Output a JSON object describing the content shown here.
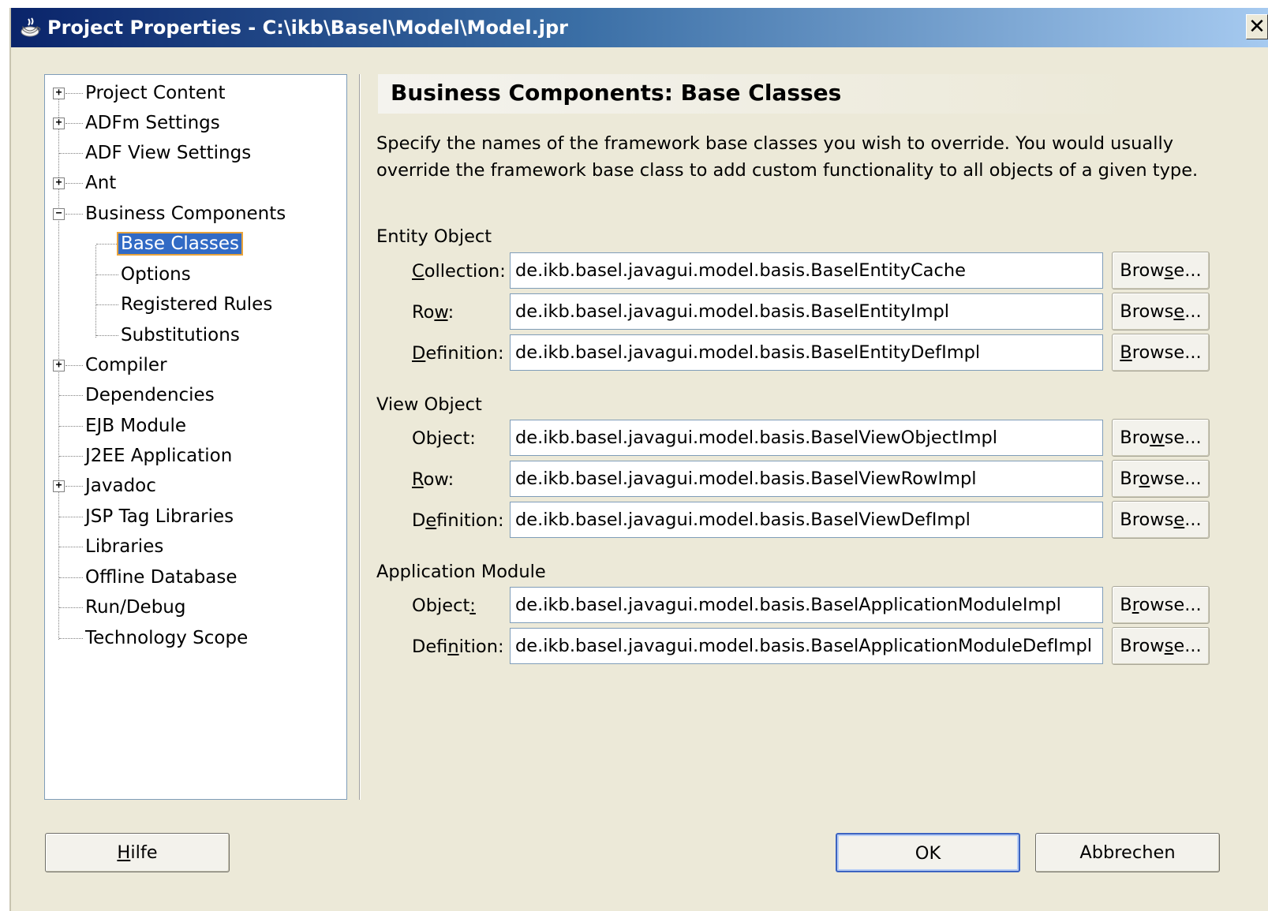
{
  "window": {
    "title": "Project Properties - C:\\ikb\\Basel\\Model\\Model.jpr",
    "close_glyph": "✕"
  },
  "tree": {
    "items": [
      {
        "label": "Project Content",
        "expander": "+"
      },
      {
        "label": "ADFm Settings",
        "expander": "+"
      },
      {
        "label": "ADF View Settings"
      },
      {
        "label": "Ant",
        "expander": "+"
      },
      {
        "label": "Business Components",
        "expander": "−"
      },
      {
        "label": "Base Classes",
        "selected": true
      },
      {
        "label": "Options"
      },
      {
        "label": "Registered Rules"
      },
      {
        "label": "Substitutions"
      },
      {
        "label": "Compiler",
        "expander": "+"
      },
      {
        "label": "Dependencies"
      },
      {
        "label": "EJB Module"
      },
      {
        "label": "J2EE Application"
      },
      {
        "label": "Javadoc",
        "expander": "+"
      },
      {
        "label": "JSP Tag Libraries"
      },
      {
        "label": "Libraries"
      },
      {
        "label": "Offline Database"
      },
      {
        "label": "Run/Debug"
      },
      {
        "label": "Technology Scope"
      }
    ]
  },
  "panel": {
    "title": "Business Components: Base Classes",
    "description_line1": "Specify the names of the framework base classes you wish to override. You would usually",
    "description_line2": "override the framework base class to add custom functionality to all objects of a given type.",
    "entity_object": {
      "label": "Entity Object",
      "collection": {
        "label_a": "",
        "label_u": "C",
        "label_b": "ollection:",
        "value": "de.ikb.basel.javagui.model.basis.BaselEntityCache"
      },
      "row": {
        "label_a": "Ro",
        "label_u": "w",
        "label_b": ":",
        "value": "de.ikb.basel.javagui.model.basis.BaselEntityImpl"
      },
      "definition": {
        "label_a": "",
        "label_u": "D",
        "label_b": "efinition:",
        "value": "de.ikb.basel.javagui.model.basis.BaselEntityDefImpl"
      }
    },
    "view_object": {
      "label": "View Object",
      "object": {
        "label_a": "Ob",
        "label_u": "j",
        "label_b": "ect:",
        "value": "de.ikb.basel.javagui.model.basis.BaselViewObjectImpl"
      },
      "row": {
        "label_a": "",
        "label_u": "R",
        "label_b": "ow:",
        "value": "de.ikb.basel.javagui.model.basis.BaselViewRowImpl"
      },
      "definition": {
        "label_a": "D",
        "label_u": "e",
        "label_b": "finition:",
        "value": "de.ikb.basel.javagui.model.basis.BaselViewDefImpl"
      }
    },
    "application_module": {
      "label": "Application Module",
      "object": {
        "label_a": "Object",
        "label_u": ":",
        "label_b": "",
        "value": "de.ikb.basel.javagui.model.basis.BaselApplicationModuleImpl"
      },
      "definition": {
        "label_a": "Defi",
        "label_u": "n",
        "label_b": "ition:",
        "value": "de.ikb.basel.javagui.model.basis.BaselApplicationModuleDefImpl"
      }
    },
    "browse_buttons": [
      {
        "a": "Brow",
        "u": "s",
        "b": "e..."
      },
      {
        "a": "Brows",
        "u": "e",
        "b": "..."
      },
      {
        "a": "",
        "u": "B",
        "b": "rowse..."
      },
      {
        "a": "Bro",
        "u": "w",
        "b": "se..."
      },
      {
        "a": "Br",
        "u": "o",
        "b": "wse..."
      },
      {
        "a": "Brows",
        "u": "e",
        "b": "..."
      },
      {
        "a": "B",
        "u": "r",
        "b": "owse..."
      },
      {
        "a": "Brow",
        "u": "s",
        "b": "e..."
      }
    ]
  },
  "footer": {
    "help": {
      "u": "H",
      "b": "ilfe"
    },
    "ok": "OK",
    "cancel": "Abbrechen"
  }
}
